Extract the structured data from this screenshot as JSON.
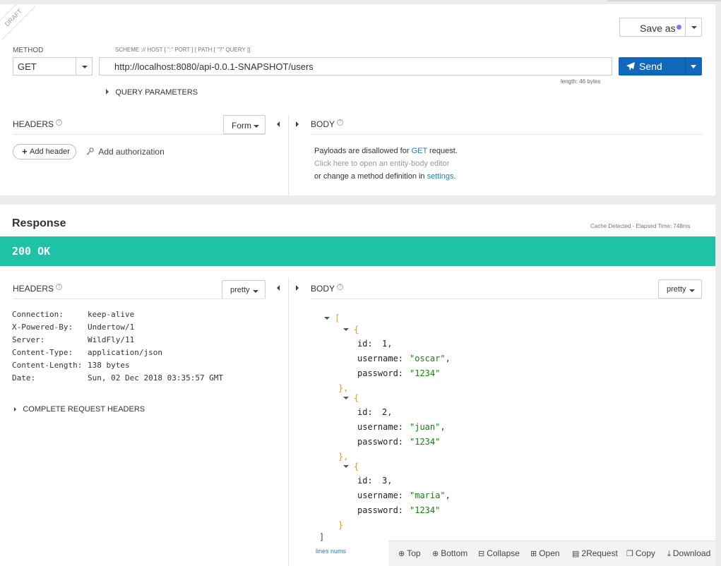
{
  "request": {
    "draft_label": "DRAFT",
    "save_as_label": "Save as",
    "method_label": "METHOD",
    "method_value": "GET",
    "url_label": "SCHEME :// HOST [ \":\" PORT ] [ PATH [ \"?\" QUERY ]]",
    "url_value": "http://localhost:8080/api-0.0.1-SNAPSHOT/users",
    "length_text": "length: 46 bytes",
    "send_label": "Send",
    "query_params_label": "QUERY PARAMETERS",
    "headers_title": "HEADERS",
    "headers_mode": "Form",
    "add_header_label": "Add header",
    "add_auth_label": "Add authorization",
    "body_title": "BODY",
    "body_msg_1_prefix": "Payloads are disallowed for ",
    "body_msg_1_method": "GET",
    "body_msg_1_suffix": " request.",
    "body_msg_2": "Click here to open an entity-body editor",
    "body_msg_3_prefix": "or change a method definition in ",
    "body_msg_3_link": "settings",
    "body_msg_3_suffix": "."
  },
  "response": {
    "title": "Response",
    "elapsed": "Cache Detected - Elapsed Time: 748ms",
    "status": "200 OK",
    "headers_title": "HEADERS",
    "headers_mode": "pretty",
    "body_title": "BODY",
    "body_mode": "pretty",
    "headers": [
      {
        "name": "Connection:",
        "value": "keep-alive"
      },
      {
        "name": "X-Powered-By:",
        "value": "Undertow/1"
      },
      {
        "name": "Server:",
        "value": "WildFly/11"
      },
      {
        "name": "Content-Type:",
        "value": "application/json"
      },
      {
        "name": "Content-Length:",
        "value": "138 bytes"
      },
      {
        "name": "Date:",
        "value": "Sun, 02 Dec 2018 03:35:57 GMT"
      }
    ],
    "complete_headers_label": "COMPLETE REQUEST HEADERS",
    "json_keys": {
      "id": "id:",
      "username": "username:",
      "password": "password:"
    },
    "users": [
      {
        "id": "1",
        "username": "\"oscar\"",
        "password": "\"1234\""
      },
      {
        "id": "2",
        "username": "\"juan\"",
        "password": "\"1234\""
      },
      {
        "id": "3",
        "username": "\"maria\"",
        "password": "\"1234\""
      }
    ],
    "lines_nums_label": "lines nums",
    "footer": {
      "top": "Top",
      "bottom": "Bottom",
      "collapse": "Collapse",
      "open": "Open",
      "to_request": "2Request",
      "copy": "Copy",
      "download": "Download"
    }
  },
  "colors": {
    "status_bar": "#1fc1a7",
    "send_button": "#1168b8",
    "json_brace": "#d8a022",
    "json_string": "#16800e",
    "link": "#1a7ec6"
  }
}
